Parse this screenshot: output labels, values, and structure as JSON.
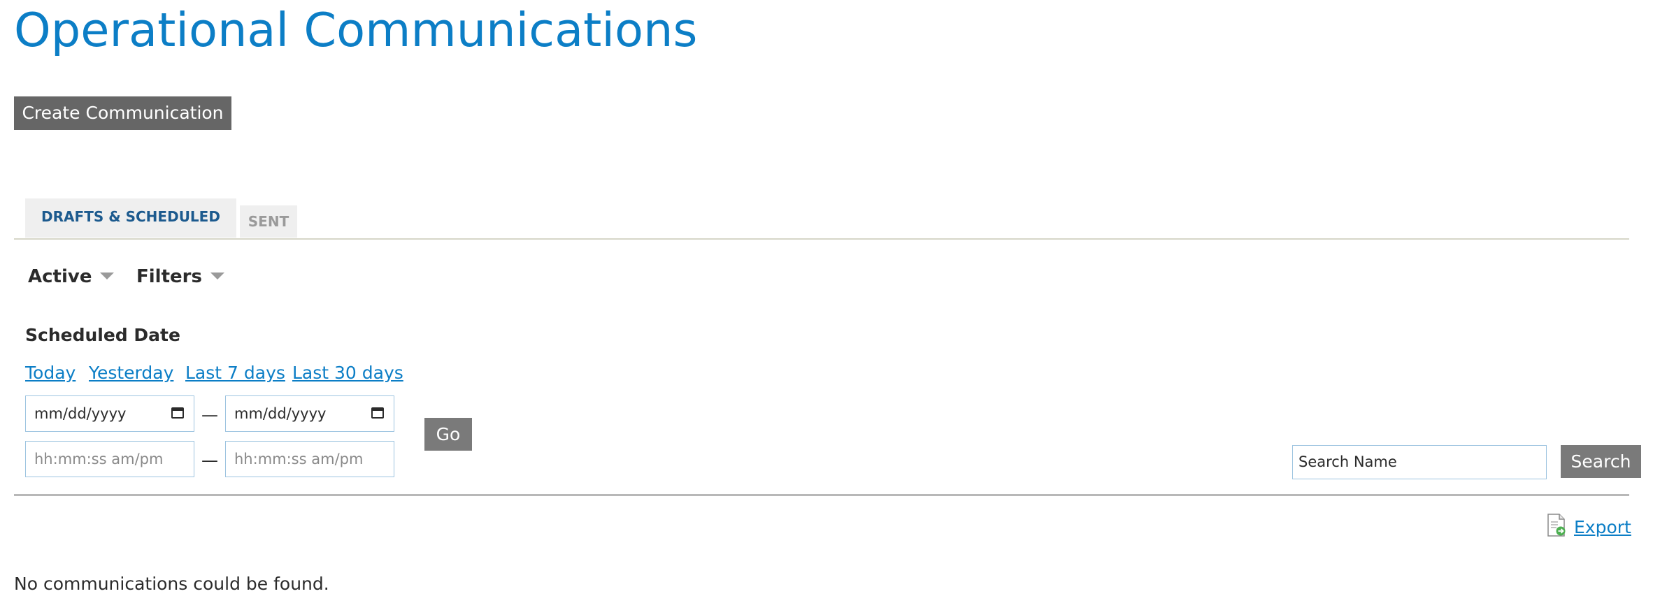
{
  "page": {
    "title": "Operational Communications",
    "create_button": "Create Communication"
  },
  "tabs": [
    {
      "label": "DRAFTS & SCHEDULED",
      "active": true
    },
    {
      "label": "SENT",
      "active": false
    }
  ],
  "filters": {
    "status_dropdown": "Active",
    "filters_dropdown": "Filters",
    "section_label": "Scheduled Date",
    "quick_links": [
      "Today",
      "Yesterday",
      "Last 7 days",
      "Last 30 days"
    ],
    "date_start_placeholder": "mm/dd/yyyy",
    "date_end_placeholder": "mm/dd/yyyy",
    "time_start_placeholder": "hh:mm:ss am/pm",
    "time_end_placeholder": "hh:mm:ss am/pm",
    "range_separator": "—",
    "go_button": "Go"
  },
  "search": {
    "placeholder": "Search Name",
    "button": "Search"
  },
  "export": {
    "label": "Export",
    "icon": "export-document-icon"
  },
  "results": {
    "empty_message": "No communications could be found."
  },
  "colors": {
    "title": "#0c7ec6",
    "link": "#0c7ec6",
    "tab_active_text": "#1c5a8e",
    "button_bg": "#666666"
  }
}
